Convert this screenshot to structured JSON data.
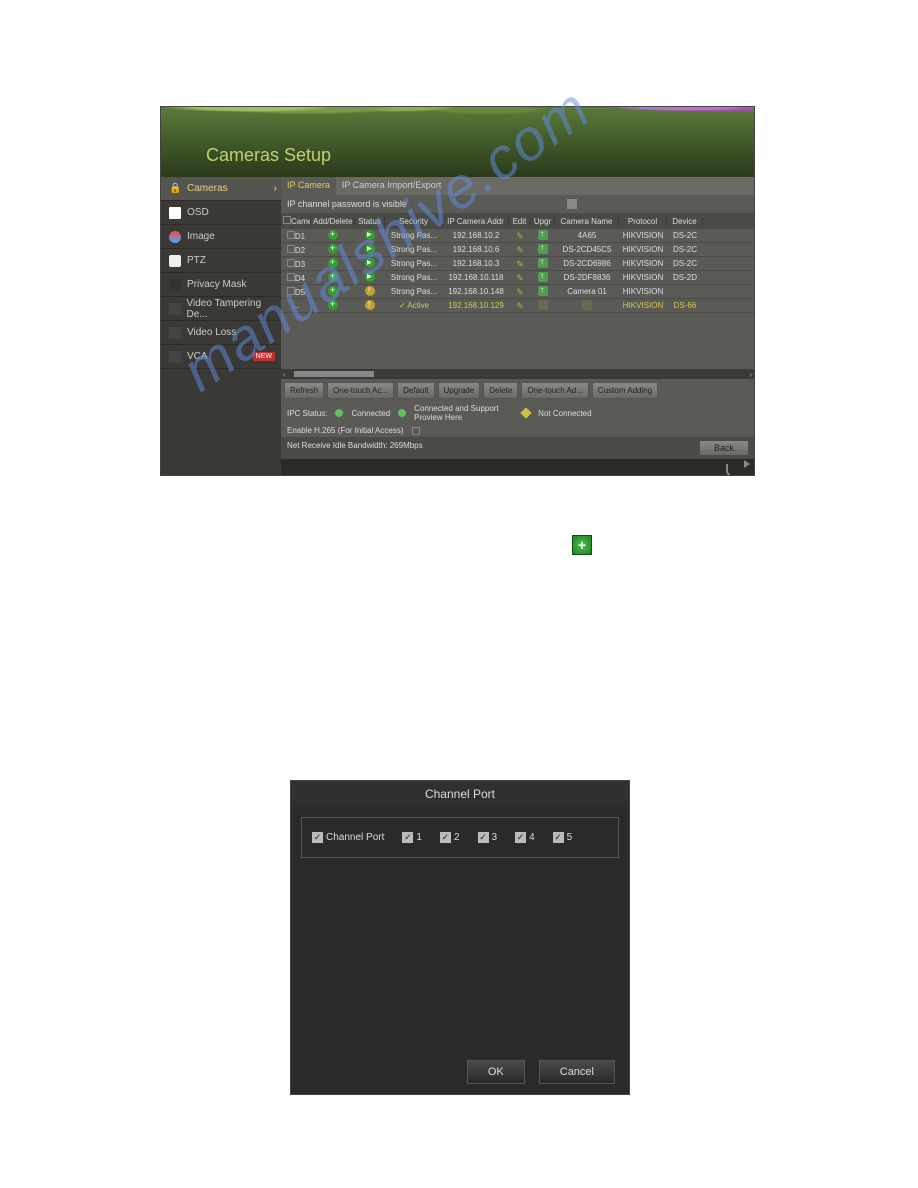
{
  "screenshot1": {
    "title": "Cameras Setup",
    "sidebar": [
      {
        "label": "Cameras",
        "active": true
      },
      {
        "label": "OSD"
      },
      {
        "label": "Image"
      },
      {
        "label": "PTZ"
      },
      {
        "label": "Privacy Mask"
      },
      {
        "label": "Video Tampering De..."
      },
      {
        "label": "Video Loss"
      },
      {
        "label": "VCA",
        "badge": "NEW"
      }
    ],
    "tabs": [
      {
        "label": "IP Camera",
        "active": true
      },
      {
        "label": "IP Camera Import/Export"
      }
    ],
    "pw_label": "IP channel password is visible",
    "columns": [
      "Camer",
      "Add/Delete",
      "Status",
      "Security",
      "IP Camera Addr",
      "Edit",
      "Upgr",
      "Camera Name",
      "Protocol",
      "Device"
    ],
    "rows": [
      {
        "cam": "D1",
        "sec": "Strong Pas...",
        "ip": "192.168.10.2",
        "name": "4A65",
        "proto": "HIKVISION",
        "dev": "DS-2C"
      },
      {
        "cam": "D2",
        "sec": "Strong Pas...",
        "ip": "192.168.10.6",
        "name": "DS-2CD45C5",
        "proto": "HIKVISION",
        "dev": "DS-2C"
      },
      {
        "cam": "D3",
        "sec": "Strong Pas...",
        "ip": "192.168.10.3",
        "name": "DS-2CD6986",
        "proto": "HIKVISION",
        "dev": "DS-2C"
      },
      {
        "cam": "D4",
        "sec": "Strong Pas...",
        "ip": "192.168.10.118",
        "name": "DS-2DF8836",
        "proto": "HIKVISION",
        "dev": "DS-2D"
      },
      {
        "cam": "D5",
        "sec": "Strong Pas...",
        "ip": "192.168.10.148",
        "name": "Camera 01",
        "proto": "HIKVISION",
        "dev": ""
      }
    ],
    "extra_row": {
      "sec": "✓ Active",
      "ip": "192.168.10.129",
      "proto": "HIKVISION",
      "dev": "DS-66"
    },
    "buttons": [
      "Refresh",
      "One-touch Ac...",
      "Default",
      "Upgrade",
      "Delete",
      "One-touch Ad...",
      "Custom Adding"
    ],
    "ipc_status_label": "IPC Status:",
    "ipc_connected": "Connected",
    "ipc_preview": "Connected and Support Proview Here",
    "ipc_notconn": "Not Connected",
    "h265_label": "Enable H.265 (For Initial Access)",
    "bandwidth": "Net Receive Idle Bandwidth: 269Mbps",
    "back": "Back"
  },
  "channel_port": {
    "title": "Channel Port",
    "label": "Channel Port",
    "items": [
      "1",
      "2",
      "3",
      "4",
      "5"
    ],
    "ok": "OK",
    "cancel": "Cancel"
  },
  "watermark": "manualshive.com"
}
